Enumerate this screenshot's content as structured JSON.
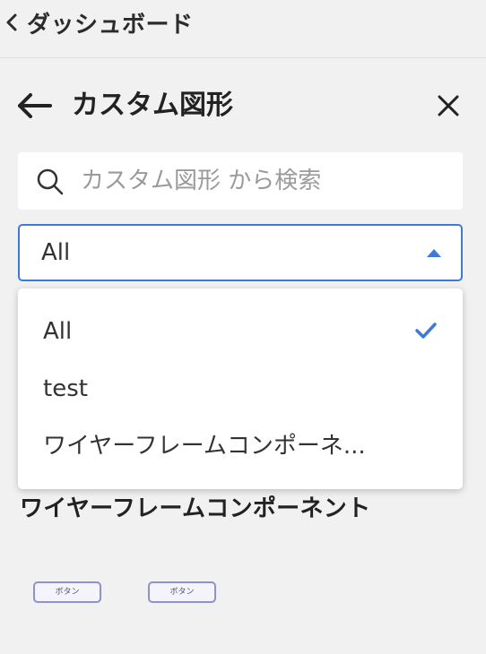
{
  "breadcrumb": {
    "label": "ダッシュボード"
  },
  "panel": {
    "title": "カスタム図形"
  },
  "search": {
    "placeholder": "カスタム図形 から検索",
    "value": ""
  },
  "filter": {
    "selected": "All",
    "options": [
      {
        "label": "All",
        "selected": true
      },
      {
        "label": "test",
        "selected": false
      },
      {
        "label": "ワイヤーフレームコンポーネ...",
        "selected": false
      }
    ]
  },
  "section": {
    "title": "ワイヤーフレームコンポーネント",
    "shapes": [
      {
        "label": "ボタン"
      },
      {
        "label": "ボタン"
      }
    ]
  },
  "colors": {
    "accent": "#3d7ad6",
    "background": "#f1f1f1",
    "shape_border": "#8f91c9"
  },
  "icons": [
    "chevron-left-icon",
    "arrow-left-icon",
    "close-icon",
    "search-icon",
    "check-icon",
    "caret-up-icon"
  ]
}
